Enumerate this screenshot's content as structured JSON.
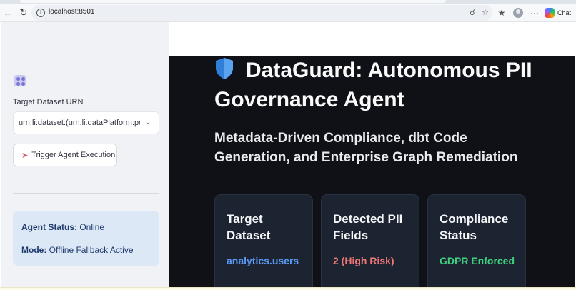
{
  "browser": {
    "url": "localhost:8501",
    "chat_label": "Chat"
  },
  "sidebar": {
    "dataset_label": "Target Dataset URN",
    "dataset_value": "urn:li:dataset:(urn:li:dataPlatform:postgres,analytics.users,PROD)",
    "trigger_label": "Trigger Agent Execution",
    "status": {
      "agent_status_label": "Agent Status:",
      "agent_status_value": "Online",
      "mode_label": "Mode:",
      "mode_value": "Offline Fallback Active"
    }
  },
  "main": {
    "title": "DataGuard: Autonomous PII Governance Agent",
    "subtitle": "Metadata-Driven Compliance, dbt Code Generation, and Enterprise Graph Remediation",
    "cards": [
      {
        "label": "Target Dataset",
        "value": "analytics.users",
        "color": "#5b9bf5"
      },
      {
        "label": "Detected PII Fields",
        "value": "2 (High Risk)",
        "color": "#f07878"
      },
      {
        "label": "Compliance Status",
        "value": "GDPR Enforced",
        "color": "#3fcf7f"
      }
    ]
  },
  "icons": {
    "back": "arrow-left-icon",
    "reload": "reload-icon",
    "info": "info-icon",
    "zoom": "zoom-icon",
    "favorite": "star-icon",
    "favorites": "favorites-bar-icon",
    "profile": "avatar-icon",
    "more": "more-icon",
    "app_logo": "app-logo-icon",
    "select_chevron": "chevron-down-icon",
    "rocket": "rocket-icon",
    "shield": "shield-icon"
  }
}
